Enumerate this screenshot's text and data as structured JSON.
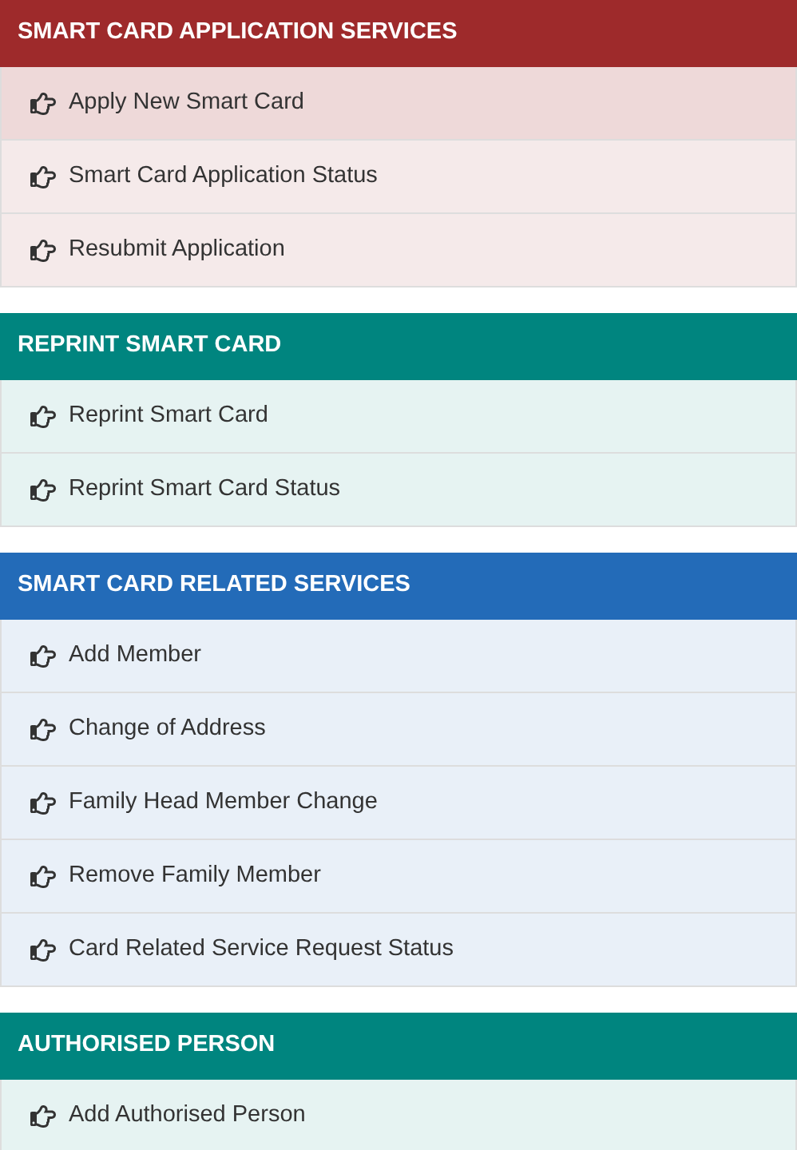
{
  "panels": [
    {
      "title": "SMART CARD APPLICATION SERVICES",
      "color": "#9e2a2b",
      "items": [
        {
          "label": "Apply New Smart Card",
          "selected": true
        },
        {
          "label": "Smart Card Application Status",
          "selected": false
        },
        {
          "label": "Resubmit Application",
          "selected": false
        }
      ]
    },
    {
      "title": "REPRINT SMART CARD",
      "color": "#00857f",
      "items": [
        {
          "label": "Reprint Smart Card",
          "selected": false
        },
        {
          "label": "Reprint Smart Card Status",
          "selected": false
        }
      ]
    },
    {
      "title": "SMART CARD RELATED SERVICES",
      "color": "#236bb8",
      "items": [
        {
          "label": "Add Member",
          "selected": false
        },
        {
          "label": "Change of Address",
          "selected": false
        },
        {
          "label": "Family Head Member Change",
          "selected": false
        },
        {
          "label": "Remove Family Member",
          "selected": false
        },
        {
          "label": "Card Related Service Request Status",
          "selected": false
        }
      ]
    },
    {
      "title": "AUTHORISED PERSON",
      "color": "#00857f",
      "items": [
        {
          "label": "Add Authorised Person",
          "selected": false
        }
      ]
    }
  ]
}
